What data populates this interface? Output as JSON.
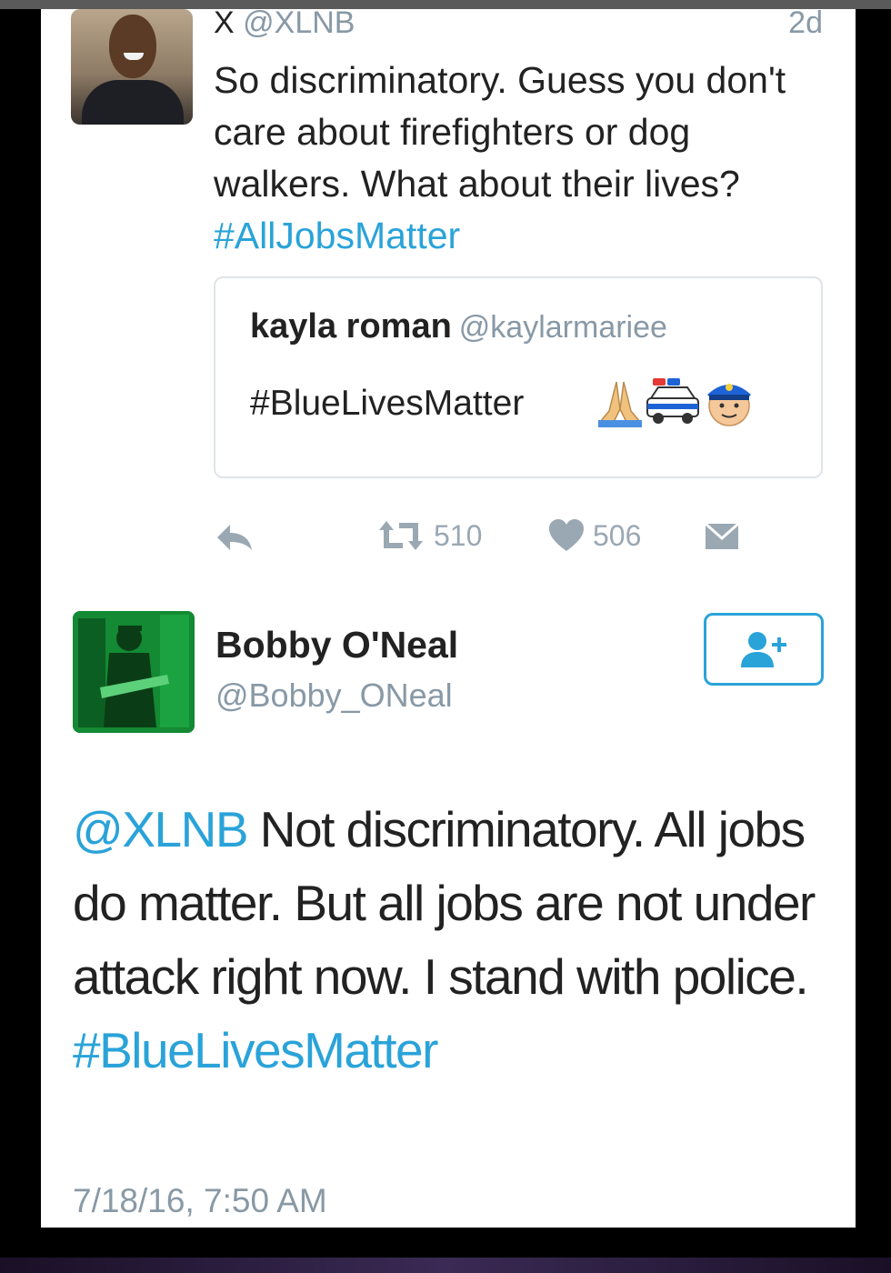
{
  "first_tweet": {
    "display_name": "X",
    "handle": "@XLNB",
    "time_ago": "2d",
    "text": "So discriminatory. Guess you don't care about firefighters or dog walkers. What about their lives? ",
    "hashtag": "#AllJobsMatter",
    "quoted": {
      "name": "kayla roman",
      "handle": "@kaylarmariee",
      "text": "#BlueLivesMatter",
      "emoji_icons": [
        "folded-hands-icon",
        "police-car-icon",
        "police-officer-icon"
      ]
    },
    "actions": {
      "reply_icon": "reply-icon",
      "retweet_icon": "retweet-icon",
      "retweets": "510",
      "like_icon": "heart-icon",
      "likes": "506",
      "dm_icon": "direct-message-icon"
    }
  },
  "second_tweet": {
    "display_name": "Bobby O'Neal",
    "handle": "@Bobby_ONeal",
    "follow_icon": "follow-user-icon",
    "mention": "@XLNB",
    "text": " Not discriminatory. All jobs do matter. But all jobs are not under attack right now. I stand with police. ",
    "hashtag": "#BlueLivesMatter",
    "timestamp": "7/18/16, 7:50 AM"
  },
  "colors": {
    "link": "#2aa3d9",
    "muted": "#8899a6",
    "text": "#222222",
    "background": "#000000"
  }
}
